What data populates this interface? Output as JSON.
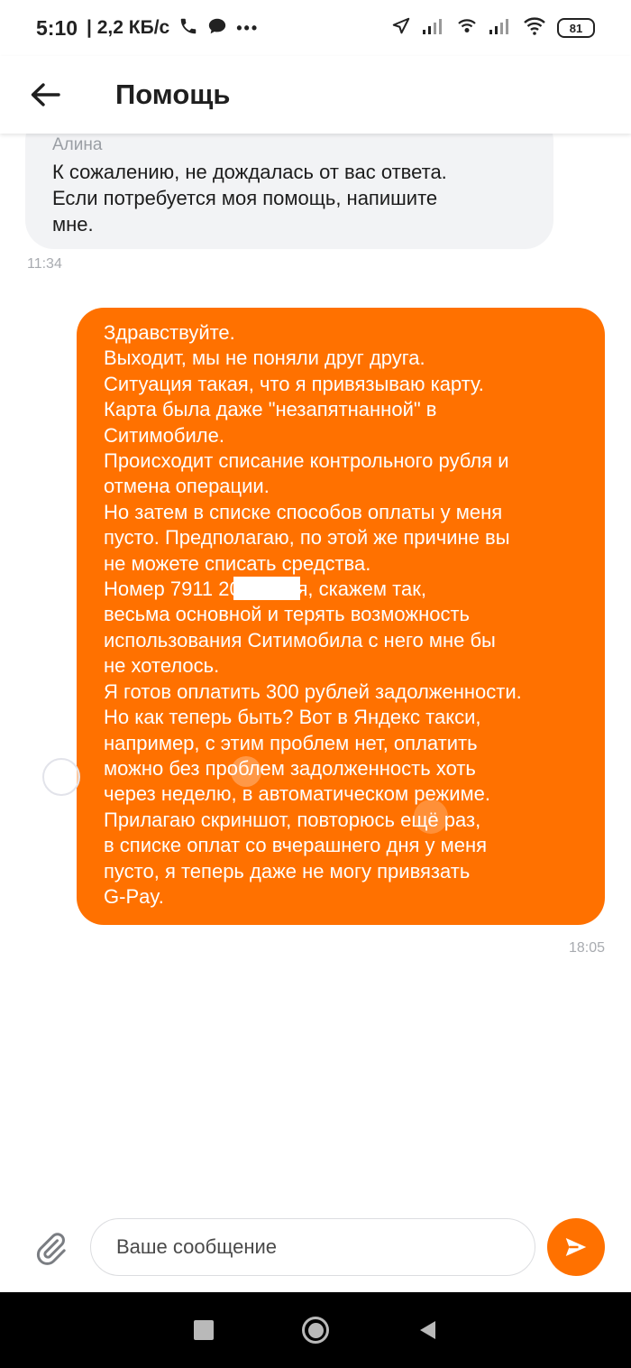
{
  "status_bar": {
    "time": "5:10",
    "network_speed": "| 2,2 КБ/с",
    "more_indicator": "•••",
    "battery": "81"
  },
  "header": {
    "title": "Помощь",
    "back_icon": "arrow-left-icon"
  },
  "chat": {
    "incoming": {
      "sender": "Алина",
      "text": "К сожалению, не дождалась от вас ответа.\nЕсли потребуется моя помощь, напишите\nмне.",
      "time": "11:34"
    },
    "outgoing": {
      "text": "Здравствуйте.\nВыходит, мы не поняли друг друга.\nСитуация такая, что я привязываю карту.\nКарта была даже \"незапятнанной\" в\nСитимобиле.\nПроисходит списание контрольного рубля и\nотмена операции.\nНо затем в списке способов оплаты у меня\nпусто. Предполагаю, по этой же причине вы\nне можете списать средства.\nНомер  7911           20 у меня, скажем так,\nвесьма основной и терять возможность\nиспользования Ситимобила с него мне бы\nне хотелось.\nЯ готов оплатить 300 рублей задолженности.\nНо как теперь быть? Вот в Яндекс такси,\nнапример, с этим проблем нет,  оплатить\nможно без проблем задолженность хоть\nчерез неделю, в автоматическом режиме.\nПрилагаю скриншот, повторюсь ещё раз,\nв списке оплат со вчерашнего дня у меня\nпусто, я теперь даже не могу привязать\nG-Pay.",
      "time": "18:05"
    }
  },
  "input": {
    "placeholder": "Ваше сообщение",
    "value": ""
  },
  "colors": {
    "accent": "#ff7100",
    "incoming_bubble": "#f2f3f5",
    "timestamp": "#a8abb0"
  },
  "icons": {
    "attach": "paperclip-icon",
    "send": "send-icon",
    "nav_recents": "square-icon",
    "nav_home": "circle-icon",
    "nav_back": "triangle-back-icon"
  }
}
